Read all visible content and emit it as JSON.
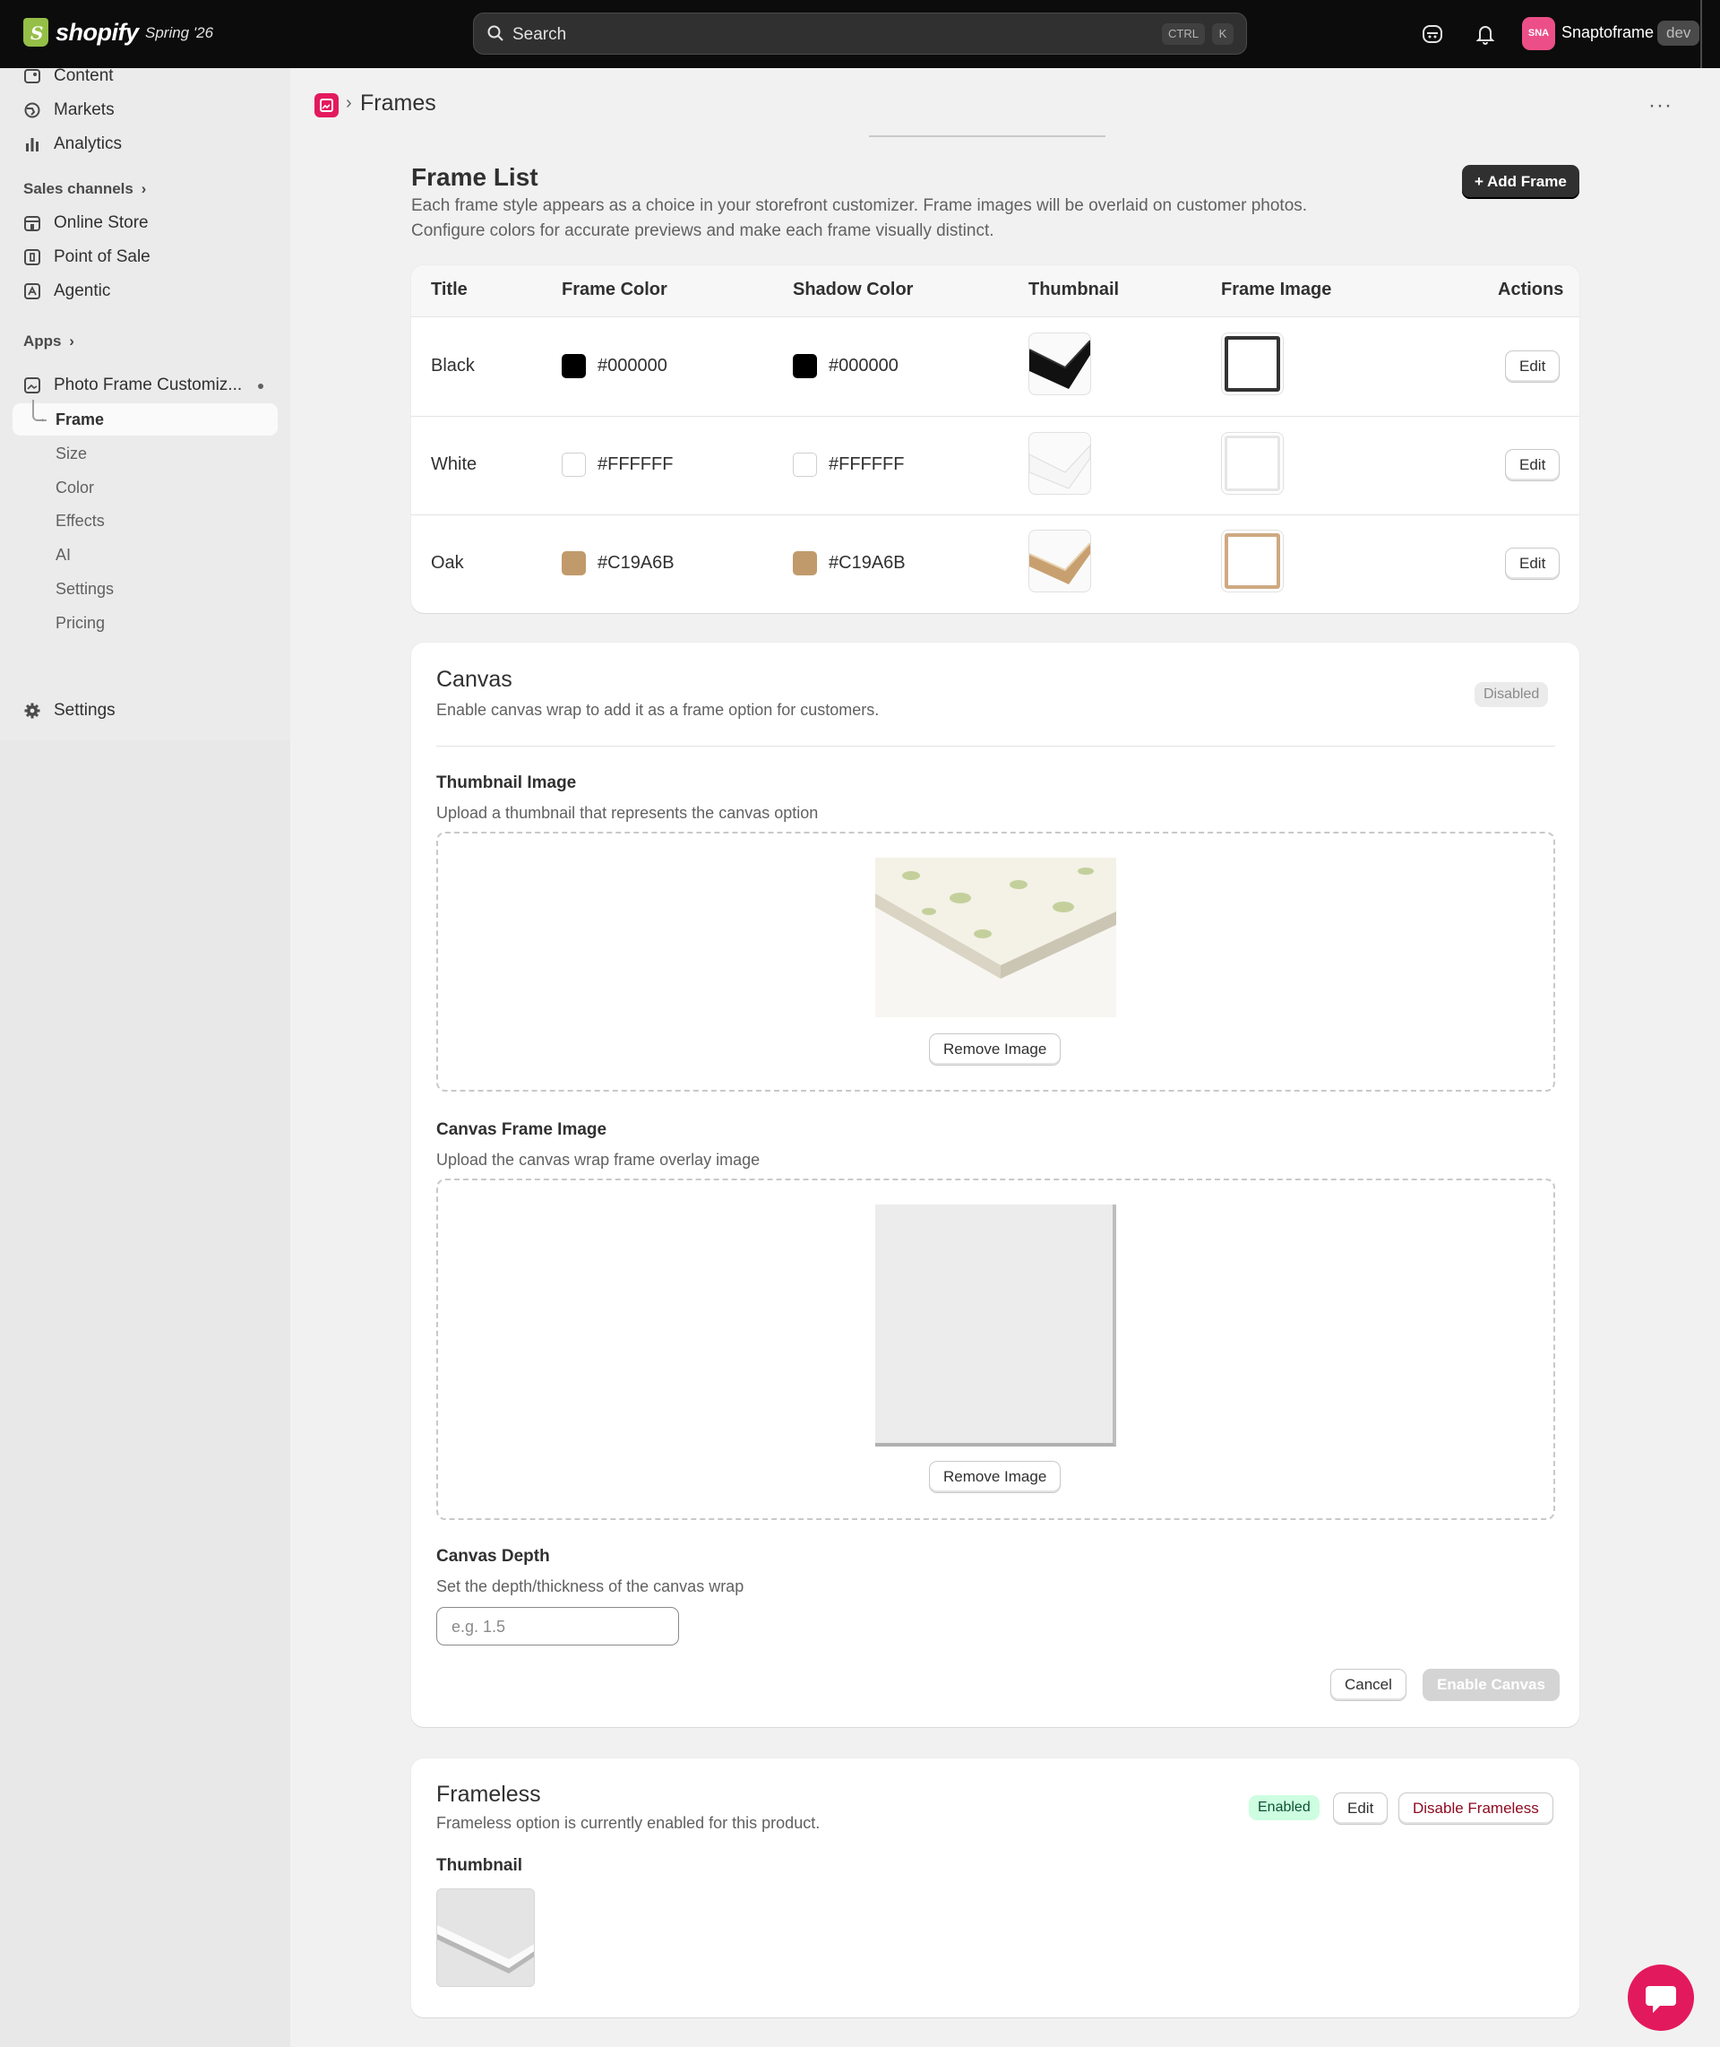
{
  "topbar": {
    "brand": "shopify",
    "edition": "Spring '26",
    "search_placeholder": "Search",
    "kbd_ctrl": "CTRL",
    "kbd_k": "K",
    "avatar_initials": "SNA",
    "store_name": "Snaptoframe",
    "env_tag": "dev"
  },
  "sidebar": {
    "items": [
      {
        "label": "Content",
        "icon": "content-icon"
      },
      {
        "label": "Markets",
        "icon": "globe-icon"
      },
      {
        "label": "Analytics",
        "icon": "bar-chart-icon"
      }
    ],
    "sales_channels_label": "Sales channels",
    "channels": [
      {
        "label": "Online Store",
        "icon": "store-icon"
      },
      {
        "label": "Point of Sale",
        "icon": "pos-icon"
      },
      {
        "label": "Agentic",
        "icon": "agentic-icon"
      }
    ],
    "apps_label": "Apps",
    "app_name": "Photo Frame Customiz...",
    "app_subitems": [
      "Frame",
      "Size",
      "Color",
      "Effects",
      "AI",
      "Settings",
      "Pricing"
    ],
    "settings_label": "Settings"
  },
  "page": {
    "title": "Frames"
  },
  "frame_list": {
    "title": "Frame List",
    "description_1": "Each frame style appears as a choice in your storefront customizer. Frame images will be overlaid on customer photos.",
    "description_2": "Configure colors for accurate previews and make each frame visually distinct.",
    "add_button": "+ Add Frame",
    "columns": [
      "Title",
      "Frame Color",
      "Shadow Color",
      "Thumbnail",
      "Frame Image",
      "Actions"
    ],
    "rows": [
      {
        "title": "Black",
        "frame_color": "#000000",
        "shadow_color": "#000000",
        "action": "Edit"
      },
      {
        "title": "White",
        "frame_color": "#FFFFFF",
        "shadow_color": "#FFFFFF",
        "action": "Edit"
      },
      {
        "title": "Oak",
        "frame_color": "#C19A6B",
        "shadow_color": "#C19A6B",
        "action": "Edit"
      }
    ]
  },
  "canvas": {
    "title": "Canvas",
    "description": "Enable canvas wrap to add it as a frame option for customers.",
    "status": "Disabled",
    "thumbnail_label": "Thumbnail Image",
    "thumbnail_help": "Upload a thumbnail that represents the canvas option",
    "remove_image": "Remove Image",
    "frame_image_label": "Canvas Frame Image",
    "frame_image_help": "Upload the canvas wrap frame overlay image",
    "depth_label": "Canvas Depth",
    "depth_help": "Set the depth/thickness of the canvas wrap",
    "depth_placeholder": "e.g. 1.5",
    "cancel": "Cancel",
    "enable": "Enable Canvas"
  },
  "frameless": {
    "title": "Frameless",
    "description": "Frameless option is currently enabled for this product.",
    "status": "Enabled",
    "edit": "Edit",
    "disable": "Disable Frameless",
    "thumbnail_label": "Thumbnail"
  },
  "colors": {
    "accent": "#e3195d",
    "success_bg": "#cdfee1",
    "success_text": "#0c5132",
    "critical_text": "#8e0b21"
  }
}
